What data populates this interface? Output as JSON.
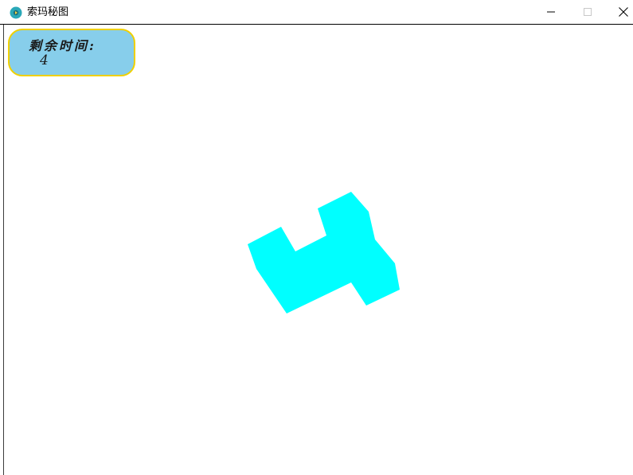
{
  "window": {
    "title": "索玛秘图",
    "icon": "app-logo-icon",
    "controls": [
      "minimize-icon",
      "maximize-icon",
      "close-icon"
    ]
  },
  "timer": {
    "label": "剩余时间:",
    "value": "4"
  },
  "colors": {
    "piece": "#00ffff",
    "timer_background": "#87ceeb",
    "timer_border": "#f0d000",
    "app_icon": "#2aa8b8"
  }
}
